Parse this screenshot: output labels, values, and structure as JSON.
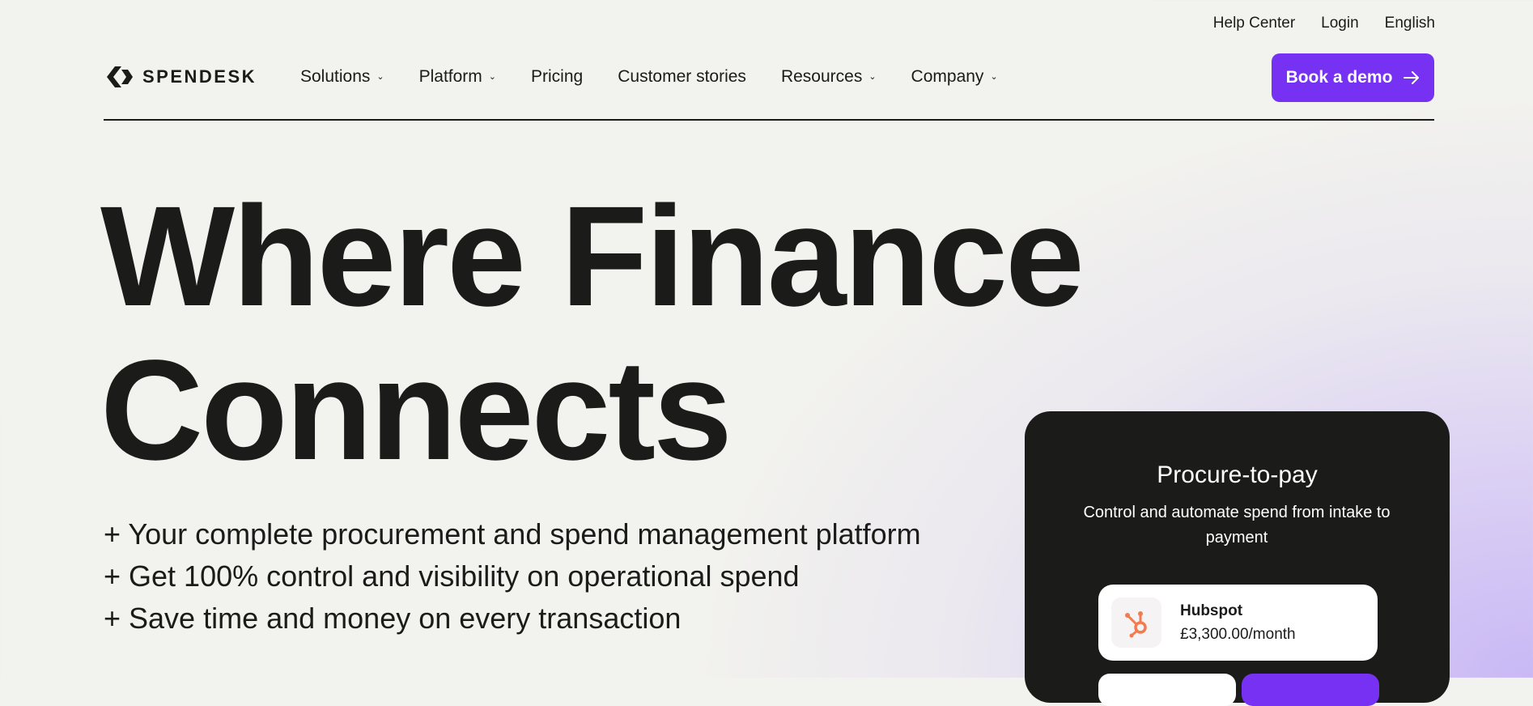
{
  "utility_nav": {
    "help_center": "Help Center",
    "login": "Login",
    "language": "English"
  },
  "brand": {
    "name": "SPENDESK",
    "logo_icon": "spendesk-chevron-logo-icon"
  },
  "main_nav": {
    "solutions": "Solutions",
    "platform": "Platform",
    "pricing": "Pricing",
    "customer_stories": "Customer stories",
    "resources": "Resources",
    "company": "Company",
    "dropdown_icon": "chevron-down-icon"
  },
  "cta": {
    "label": "Book a demo",
    "icon": "arrow-right-icon"
  },
  "hero": {
    "title_line1": "Where Finance",
    "title_line2": "Connects",
    "bullets": [
      "+ Your complete procurement and spend management platform",
      "+ Get 100% control and visibility on operational spend",
      "+ Save time and money on every transaction"
    ]
  },
  "card": {
    "title": "Procure-to-pay",
    "description": "Control and automate spend from intake to payment",
    "vendor": {
      "name": "Hubspot",
      "price": "£3,300.00/month",
      "icon": "hubspot-logo-icon"
    }
  },
  "colors": {
    "accent": "#7631f3",
    "text": "#1b1c1a",
    "background": "#f2f2ee",
    "card_background": "#1b1c1a",
    "hubspot_orange": "#f27b50"
  }
}
